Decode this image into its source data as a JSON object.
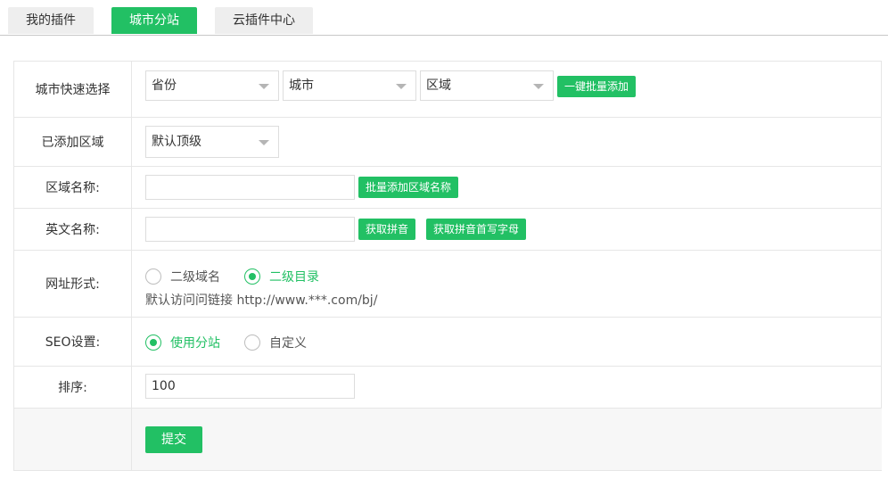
{
  "tabs": [
    {
      "label": "我的插件",
      "active": false
    },
    {
      "label": "城市分站",
      "active": true
    },
    {
      "label": "云插件中心",
      "active": false
    }
  ],
  "colors": {
    "accent": "#22c064",
    "border": "#e6e6e6"
  },
  "form": {
    "city_quick_select": {
      "label": "城市快速选择",
      "province": "省份",
      "city": "城市",
      "district": "区域",
      "batch_add_button": "一键批量添加"
    },
    "added_area": {
      "label": "已添加区域",
      "selected": "默认顶级"
    },
    "area_name": {
      "label": "区域名称:",
      "value": "",
      "batch_button": "批量添加区域名称"
    },
    "english_name": {
      "label": "英文名称:",
      "value": "",
      "pinyin_button": "获取拼音",
      "initials_button": "获取拼音首写字母"
    },
    "url_form": {
      "label": "网址形式:",
      "options": [
        "二级域名",
        "二级目录"
      ],
      "selected": "二级目录",
      "hint": "默认访问问链接 http://www.***.com/bj/"
    },
    "seo": {
      "label": "SEO设置:",
      "options": [
        "使用分站",
        "自定义"
      ],
      "selected": "使用分站"
    },
    "sort": {
      "label": "排序:",
      "value": "100"
    },
    "submit_label": "提交"
  }
}
